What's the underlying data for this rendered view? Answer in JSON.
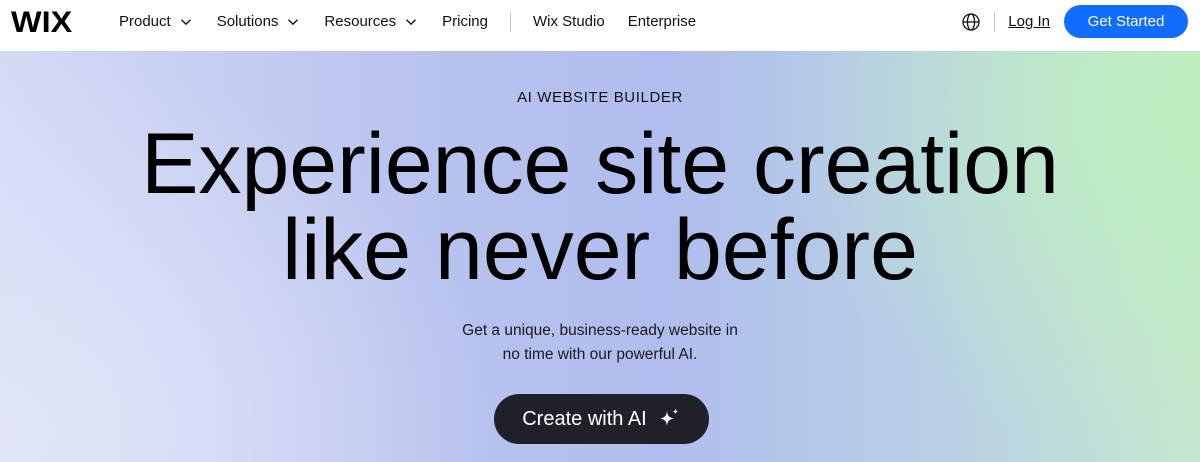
{
  "brand": {
    "logo_text": "WIX",
    "accent": "#116dff"
  },
  "nav": {
    "items": [
      {
        "label": "Product",
        "has_dropdown": true
      },
      {
        "label": "Solutions",
        "has_dropdown": true
      },
      {
        "label": "Resources",
        "has_dropdown": true
      },
      {
        "label": "Pricing",
        "has_dropdown": false
      },
      {
        "label": "Wix Studio",
        "has_dropdown": false
      },
      {
        "label": "Enterprise",
        "has_dropdown": false
      }
    ],
    "globe_icon": "globe-icon",
    "login_label": "Log In",
    "cta_label": "Get Started"
  },
  "hero": {
    "eyebrow": "AI WEBSITE BUILDER",
    "headline_line1": "Experience site creation",
    "headline_line2": "like never before",
    "subtitle_line1": "Get a unique, business-ready website in",
    "subtitle_line2": "no time with our powerful AI.",
    "button_label": "Create with AI",
    "button_icon": "sparkle-icon",
    "button_color": "#1e2129"
  }
}
